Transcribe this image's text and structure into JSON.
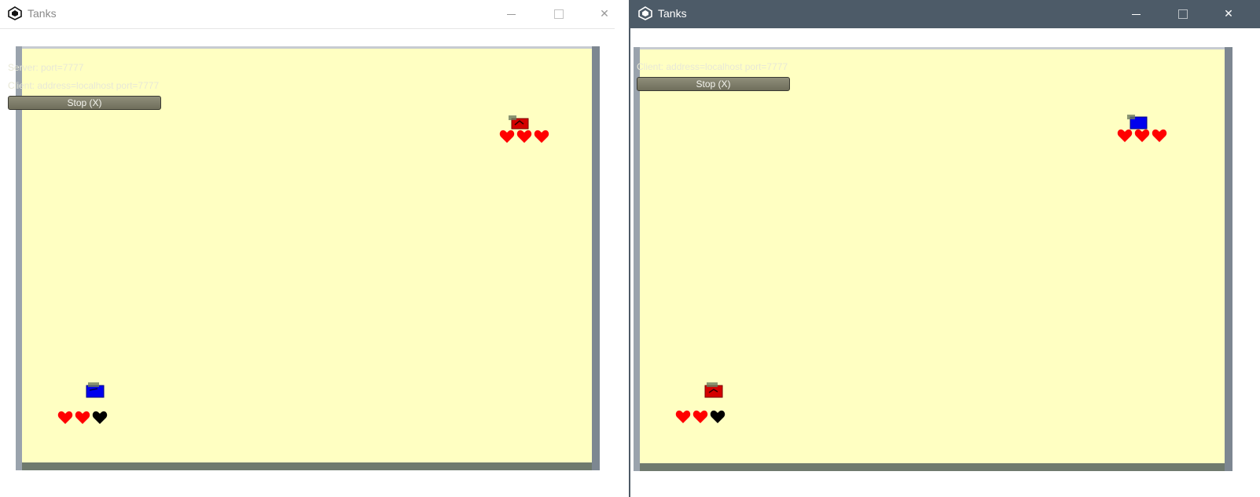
{
  "colors": {
    "arena_floor": "#ffffc2",
    "player_red": "#d40000",
    "player_blue": "#0000ee",
    "heart_full": "#ff0000",
    "heart_empty": "#000000",
    "active_titlebar": "#4d5b68"
  },
  "windows": [
    {
      "title": "Tanks",
      "active": false,
      "hud": {
        "lines": [
          "Server: port=7777",
          "Client: address=localhost port=7777"
        ],
        "stop_label": "Stop (X)"
      },
      "tanks": [
        {
          "color": "red",
          "hearts": [
            "full",
            "full",
            "full"
          ]
        },
        {
          "color": "blue",
          "hearts": [
            "full",
            "full",
            "empty"
          ]
        }
      ]
    },
    {
      "title": "Tanks",
      "active": true,
      "hud": {
        "lines": [
          "Client: address=localhost port=7777"
        ],
        "stop_label": "Stop (X)"
      },
      "tanks": [
        {
          "color": "blue",
          "hearts": [
            "full",
            "full",
            "full"
          ]
        },
        {
          "color": "red",
          "hearts": [
            "full",
            "full",
            "empty"
          ]
        }
      ]
    }
  ]
}
